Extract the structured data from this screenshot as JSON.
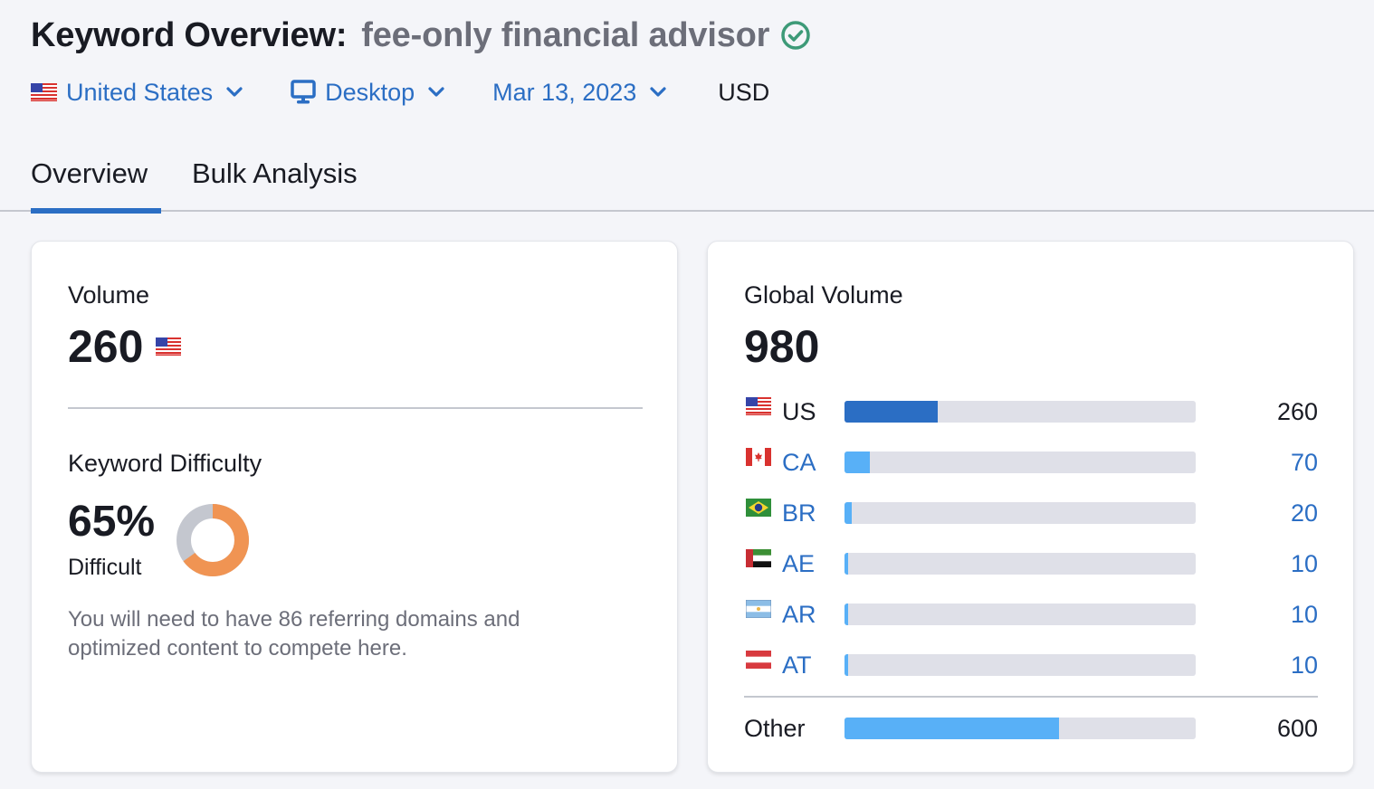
{
  "header": {
    "title_label": "Keyword Overview:",
    "keyword": "fee-only financial advisor",
    "verified_icon": "check-circle-icon",
    "verified_color": "#3d9a78"
  },
  "filters": {
    "database": {
      "label": "United States",
      "icon": "us-flag-icon"
    },
    "device": {
      "label": "Desktop",
      "icon": "desktop-monitor-icon"
    },
    "date": {
      "label": "Mar 13, 2023"
    },
    "currency": "USD"
  },
  "tabs": [
    {
      "label": "Overview",
      "active": true
    },
    {
      "label": "Bulk Analysis",
      "active": false
    }
  ],
  "volume_card": {
    "volume_label": "Volume",
    "volume_value": "260",
    "volume_flag": "us-flag-icon",
    "kd_label": "Keyword Difficulty",
    "kd_value": "65%",
    "kd_percent": 65,
    "kd_level": "Difficult",
    "kd_description": "You will need to have 86 referring domains and optimized content to compete here.",
    "kd_color": "#f09453",
    "kd_track_color": "#c4c7cf"
  },
  "global_card": {
    "label": "Global Volume",
    "value": "980",
    "countries": [
      {
        "code": "US",
        "value": "260",
        "share": 26.5,
        "flag": "us-flag-icon",
        "bar_color": "#2b6ec4",
        "is_link": false
      },
      {
        "code": "CA",
        "value": "70",
        "share": 7.1,
        "flag": "ca-flag-icon",
        "bar_color": "#58b0f7",
        "is_link": true
      },
      {
        "code": "BR",
        "value": "20",
        "share": 2.0,
        "flag": "br-flag-icon",
        "bar_color": "#58b0f7",
        "is_link": true
      },
      {
        "code": "AE",
        "value": "10",
        "share": 1.0,
        "flag": "ae-flag-icon",
        "bar_color": "#58b0f7",
        "is_link": true
      },
      {
        "code": "AR",
        "value": "10",
        "share": 1.0,
        "flag": "ar-flag-icon",
        "bar_color": "#58b0f7",
        "is_link": true
      },
      {
        "code": "AT",
        "value": "10",
        "share": 1.0,
        "flag": "at-flag-icon",
        "bar_color": "#58b0f7",
        "is_link": true
      }
    ],
    "other": {
      "label": "Other",
      "value": "600",
      "share": 61.2,
      "bar_color": "#58b0f7"
    }
  }
}
